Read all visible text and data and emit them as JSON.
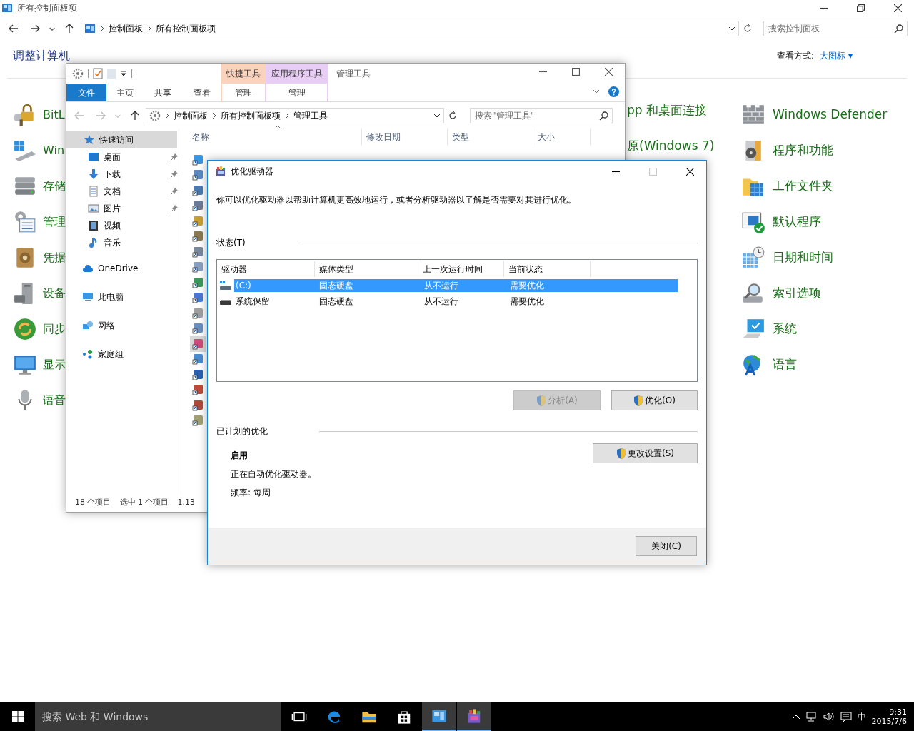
{
  "control_panel": {
    "title": "所有控制面板项",
    "address": [
      "控制面板",
      "所有控制面板项"
    ],
    "search": {
      "placeholder": "搜索控制面板"
    },
    "heading": "调整计算机",
    "view_label": "查看方式:",
    "view_value": "大图标",
    "view_caret": "▾",
    "column_1": [
      "BitL",
      "Win",
      "存储",
      "管理",
      "凭据",
      "设备",
      "同步",
      "显示",
      "语音"
    ],
    "column_2": [
      "pp 和桌面连接",
      "原(Windows 7)"
    ],
    "column_3": [
      "Windows Defender",
      "程序和功能",
      "工作文件夹",
      "默认程序",
      "日期和时间",
      "索引选项",
      "系统",
      "语言"
    ]
  },
  "explorer": {
    "title": "管理工具",
    "context_groups": [
      {
        "label": "快捷工具",
        "color": "#fbd3bd",
        "tab": "管理"
      },
      {
        "label": "应用程序工具",
        "color": "#e8cdf4",
        "tab": "管理"
      }
    ],
    "tabs": [
      {
        "label": "文件",
        "selected": true
      },
      {
        "label": "主页",
        "selected": false
      },
      {
        "label": "共享",
        "selected": false
      },
      {
        "label": "查看",
        "selected": false
      }
    ],
    "address": [
      "控制面板",
      "所有控制面板项",
      "管理工具"
    ],
    "search": {
      "placeholder": "搜索\"管理工具\""
    },
    "nav": [
      {
        "label": "快速访问",
        "selected": true,
        "children": [
          {
            "label": "桌面",
            "selected": false,
            "pinned": true
          },
          {
            "label": "下载",
            "selected": false,
            "pinned": true
          },
          {
            "label": "文档",
            "selected": false,
            "pinned": true
          },
          {
            "label": "图片",
            "selected": false,
            "pinned": true
          },
          {
            "label": "视频",
            "selected": false,
            "pinned": false
          },
          {
            "label": "音乐",
            "selected": false,
            "pinned": false
          }
        ]
      },
      {
        "label": "OneDrive",
        "selected": false
      },
      {
        "label": "此电脑",
        "selected": false
      },
      {
        "label": "网络",
        "selected": false
      },
      {
        "label": "家庭组",
        "selected": false
      }
    ],
    "columns": [
      "名称",
      "修改日期",
      "类型",
      "大小"
    ],
    "files": [
      {
        "selected": false
      },
      {
        "selected": false
      },
      {
        "selected": false
      },
      {
        "selected": false
      },
      {
        "selected": false
      },
      {
        "selected": false
      },
      {
        "selected": false
      },
      {
        "selected": false
      },
      {
        "selected": false
      },
      {
        "selected": false
      },
      {
        "selected": false
      },
      {
        "selected": false
      },
      {
        "selected": true
      },
      {
        "selected": false
      },
      {
        "selected": false
      },
      {
        "selected": false
      },
      {
        "selected": false
      },
      {
        "selected": false
      }
    ],
    "status": [
      "18 个项目",
      "选中 1 个项目",
      "1.13"
    ]
  },
  "dialog": {
    "title": "优化驱动器",
    "description": "你可以优化驱动器以帮助计算机更高效地运行，或者分析驱动器以了解是否需要对其进行优化。",
    "status_label": "状态(T)",
    "columns": [
      "驱动器",
      "媒体类型",
      "上一次运行时间",
      "当前状态"
    ],
    "rows": [
      {
        "cells": [
          "(C:)",
          "固态硬盘",
          "从不运行",
          "需要优化"
        ],
        "selected": true
      },
      {
        "cells": [
          "系统保留",
          "固态硬盘",
          "从不运行",
          "需要优化"
        ],
        "selected": false
      }
    ],
    "actions": [
      {
        "label": "分析(A)",
        "disabled": true
      },
      {
        "label": "优化(O)",
        "disabled": false
      }
    ],
    "schedule": {
      "label": "已计划的优化",
      "state": "启用",
      "description": "正在自动优化驱动器。",
      "frequency": "频率: 每周",
      "button": "更改设置(S)"
    },
    "close_button": "关闭(C)"
  },
  "taskbar": {
    "search": {
      "placeholder": "搜索 Web 和 Windows"
    },
    "apps": [
      {
        "active": false
      },
      {
        "active": false
      },
      {
        "active": false
      },
      {
        "active": false
      },
      {
        "active": true
      },
      {
        "active": true
      }
    ],
    "ime": "中",
    "time": "9:31",
    "date": "2015/7/6"
  }
}
